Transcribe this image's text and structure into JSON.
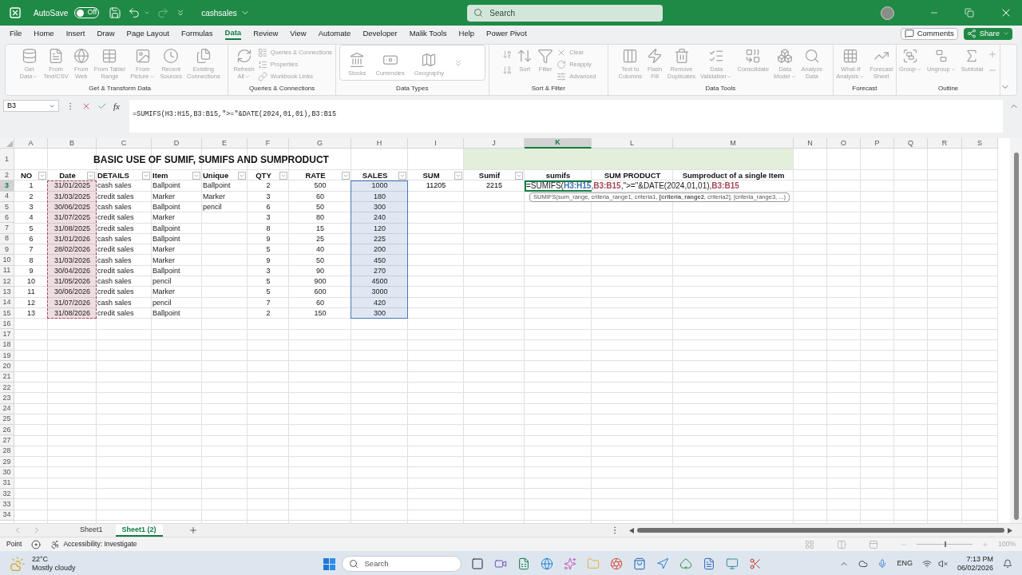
{
  "title_bar": {
    "autosave_label": "AutoSave",
    "autosave": {
      "on": false,
      "label": "Off"
    },
    "redo_disabled": true,
    "file_name": "cashsales",
    "search_placeholder": "Search"
  },
  "menu_tabs": [
    {
      "label": "File",
      "selected": false
    },
    {
      "label": "Home",
      "selected": false
    },
    {
      "label": "Insert",
      "selected": false
    },
    {
      "label": "Draw",
      "selected": false
    },
    {
      "label": "Page Layout",
      "selected": false
    },
    {
      "label": "Formulas",
      "selected": false
    },
    {
      "label": "Data",
      "selected": true
    },
    {
      "label": "Review",
      "selected": false
    },
    {
      "label": "View",
      "selected": false
    },
    {
      "label": "Automate",
      "selected": false
    },
    {
      "label": "Developer",
      "selected": false
    },
    {
      "label": "Malik Tools",
      "selected": false
    },
    {
      "label": "Help",
      "selected": false
    },
    {
      "label": "Power Pivot",
      "selected": false
    }
  ],
  "comments_label": "Comments",
  "share_label": "Share",
  "ribbon": {
    "disabled": true,
    "groups": [
      {
        "title": "Get & Transform Data",
        "kind": "buttons",
        "buttons": [
          {
            "kind": "large",
            "label": "Get\nData",
            "dropdown": true
          },
          {
            "kind": "large",
            "label": "From\nText/CSV",
            "dropdown": false
          },
          {
            "kind": "large",
            "label": "From\nWeb",
            "dropdown": false
          },
          {
            "kind": "large",
            "label": "From Table/\nRange",
            "dropdown": false
          },
          {
            "kind": "large",
            "label": "From\nPicture",
            "dropdown": true
          },
          {
            "kind": "large",
            "label": "Recent\nSources",
            "dropdown": false
          },
          {
            "kind": "large",
            "label": "Existing\nConnections",
            "dropdown": false
          }
        ]
      },
      {
        "title": "Queries & Connections",
        "kind": "buttons",
        "buttons": [
          {
            "kind": "large",
            "label": "Refresh\nAll",
            "dropdown": true
          },
          {
            "kind": "small",
            "label": "Queries & Connections",
            "dropdown": false
          },
          {
            "kind": "small",
            "label": "Properties",
            "dropdown": false
          },
          {
            "kind": "small",
            "label": "Workbook Links",
            "dropdown": false
          }
        ]
      },
      {
        "title": "Data Types",
        "kind": "gallery",
        "buttons": [
          {
            "kind": "large",
            "label": "Stocks",
            "dropdown": false
          },
          {
            "kind": "large",
            "label": "Currencies",
            "dropdown": false
          },
          {
            "kind": "large",
            "label": "Geography",
            "dropdown": false
          },
          {
            "kind": "icon",
            "dropdown": false
          }
        ]
      },
      {
        "title": "Sort & Filter",
        "kind": "buttons",
        "buttons": [
          {
            "kind": "icon",
            "dropdown": false
          },
          {
            "kind": "icon",
            "dropdown": false
          },
          {
            "kind": "large",
            "label": "Sort",
            "dropdown": false
          },
          {
            "kind": "large",
            "label": "Filter",
            "dropdown": false
          },
          {
            "kind": "small",
            "label": "Clear",
            "dropdown": false
          },
          {
            "kind": "small",
            "label": "Reapply",
            "dropdown": false
          },
          {
            "kind": "small",
            "label": "Advanced",
            "dropdown": false
          }
        ]
      },
      {
        "title": "Data Tools",
        "kind": "buttons",
        "buttons": [
          {
            "kind": "large",
            "label": "Text to\nColumns",
            "dropdown": false
          },
          {
            "kind": "large",
            "label": "Flash\nFill",
            "dropdown": false
          },
          {
            "kind": "large",
            "label": "Remove\nDuplicates",
            "dropdown": false
          },
          {
            "kind": "large",
            "label": "Data\nValidation",
            "dropdown": true
          },
          {
            "kind": "large",
            "label": "Consolidate",
            "dropdown": false
          },
          {
            "kind": "large",
            "label": "Data\nModel",
            "dropdown": true
          },
          {
            "kind": "large",
            "label": "Analyze\nData",
            "dropdown": false
          }
        ]
      },
      {
        "title": "Forecast",
        "kind": "buttons",
        "buttons": [
          {
            "kind": "large",
            "label": "What-If\nAnalysis",
            "dropdown": true
          },
          {
            "kind": "large",
            "label": "Forecast\nSheet",
            "dropdown": false
          }
        ]
      },
      {
        "title": "Outline",
        "kind": "buttons",
        "buttons": [
          {
            "kind": "large",
            "label": "Group",
            "dropdown": true
          },
          {
            "kind": "large",
            "label": "Ungroup",
            "dropdown": true
          },
          {
            "kind": "large",
            "label": "Subtotal",
            "dropdown": false
          },
          {
            "kind": "icon",
            "dropdown": false
          },
          {
            "kind": "icon",
            "dropdown": false
          }
        ]
      }
    ]
  },
  "formula_bar": {
    "name_box": "B3",
    "function_label": "fx",
    "formula": "=SUMIFS(H3:H15,B3:B15,\">=\"&DATE(2024,01,01),B3:B15"
  },
  "sheet": {
    "columns": [
      {
        "label": "A",
        "selected": false
      },
      {
        "label": "B",
        "selected": false
      },
      {
        "label": "C",
        "selected": false
      },
      {
        "label": "D",
        "selected": false
      },
      {
        "label": "E",
        "selected": false
      },
      {
        "label": "F",
        "selected": false
      },
      {
        "label": "G",
        "selected": false
      },
      {
        "label": "H",
        "selected": false
      },
      {
        "label": "I",
        "selected": false
      },
      {
        "label": "J",
        "selected": false
      },
      {
        "label": "K",
        "selected": true
      },
      {
        "label": "L",
        "selected": false
      },
      {
        "label": "M",
        "selected": false
      },
      {
        "label": "N",
        "selected": false
      },
      {
        "label": "O",
        "selected": false
      },
      {
        "label": "P",
        "selected": false
      },
      {
        "label": "Q",
        "selected": false
      },
      {
        "label": "R",
        "selected": false
      },
      {
        "label": "S",
        "selected": false
      }
    ],
    "rows": [
      {
        "label": "1",
        "selected": false
      },
      {
        "label": "2",
        "selected": false
      },
      {
        "label": "3",
        "selected": true
      },
      {
        "label": "4",
        "selected": false
      },
      {
        "label": "5",
        "selected": false
      },
      {
        "label": "6",
        "selected": false
      },
      {
        "label": "7",
        "selected": false
      },
      {
        "label": "8",
        "selected": false
      },
      {
        "label": "9",
        "selected": false
      },
      {
        "label": "10",
        "selected": false
      },
      {
        "label": "11",
        "selected": false
      },
      {
        "label": "12",
        "selected": false
      },
      {
        "label": "13",
        "selected": false
      },
      {
        "label": "14",
        "selected": false
      },
      {
        "label": "15",
        "selected": false
      },
      {
        "label": "16",
        "selected": false
      },
      {
        "label": "17",
        "selected": false
      },
      {
        "label": "18",
        "selected": false
      },
      {
        "label": "19",
        "selected": false
      },
      {
        "label": "20",
        "selected": false
      },
      {
        "label": "21",
        "selected": false
      },
      {
        "label": "22",
        "selected": false
      },
      {
        "label": "23",
        "selected": false
      },
      {
        "label": "24",
        "selected": false
      },
      {
        "label": "25",
        "selected": false
      },
      {
        "label": "26",
        "selected": false
      },
      {
        "label": "27",
        "selected": false
      },
      {
        "label": "28",
        "selected": false
      },
      {
        "label": "29",
        "selected": false
      },
      {
        "label": "30",
        "selected": false
      },
      {
        "label": "31",
        "selected": false
      },
      {
        "label": "32",
        "selected": false
      },
      {
        "label": "33",
        "selected": false
      },
      {
        "label": "34",
        "selected": false
      }
    ],
    "title": "BASIC USE OF SUMIF, SUMIFS AND SUMPRODUCT",
    "table": {
      "columns": [
        {
          "header": "NO",
          "filter": true
        },
        {
          "header": "Date",
          "filter": true,
          "reference": {
            "color": "#a8475a",
            "kind": "dashed"
          }
        },
        {
          "header": "DETAILS",
          "filter": true
        },
        {
          "header": "Item",
          "filter": true
        },
        {
          "header": "Unique",
          "filter": true
        },
        {
          "header": "QTY",
          "filter": true
        },
        {
          "header": "RATE",
          "filter": true
        },
        {
          "header": "SALES",
          "filter": true,
          "reference": {
            "color": "#4a78b5",
            "kind": "solid"
          }
        },
        {
          "header": "SUM",
          "filter": true
        },
        {
          "header": "Sumif",
          "filter": true
        },
        {
          "header": "sumifs",
          "filter": false
        },
        {
          "header": "SUM PRODUCT",
          "filter": false
        },
        {
          "header": "Sumproduct of a single Item",
          "filter": false
        }
      ],
      "rows": [
        {
          "no": "1",
          "date": "31/01/2025",
          "details": "cash sales",
          "item": "Ballpoint",
          "unique": "Ballpoint",
          "qty": "2",
          "rate": "500",
          "sales": "1000"
        },
        {
          "no": "2",
          "date": "31/03/2025",
          "details": "credit sales",
          "item": "Marker",
          "unique": "Marker",
          "qty": "3",
          "rate": "60",
          "sales": "180"
        },
        {
          "no": "3",
          "date": "30/06/2025",
          "details": "cash sales",
          "item": "Ballpoint",
          "unique": "pencil",
          "qty": "6",
          "rate": "50",
          "sales": "300"
        },
        {
          "no": "4",
          "date": "31/07/2025",
          "details": "credit sales",
          "item": "Marker",
          "qty": "3",
          "rate": "80",
          "sales": "240"
        },
        {
          "no": "5",
          "date": "31/08/2025",
          "details": "credit sales",
          "item": "Ballpoint",
          "qty": "8",
          "rate": "15",
          "sales": "120"
        },
        {
          "no": "6",
          "date": "31/01/2026",
          "details": "cash sales",
          "item": "Ballpoint",
          "qty": "9",
          "rate": "25",
          "sales": "225"
        },
        {
          "no": "7",
          "date": "28/02/2026",
          "details": "credit sales",
          "item": "Marker",
          "qty": "5",
          "rate": "40",
          "sales": "200"
        },
        {
          "no": "8",
          "date": "31/03/2026",
          "details": "cash sales",
          "item": "Marker",
          "qty": "9",
          "rate": "50",
          "sales": "450"
        },
        {
          "no": "9",
          "date": "30/04/2026",
          "details": "credit sales",
          "item": "Ballpoint",
          "qty": "3",
          "rate": "90",
          "sales": "270"
        },
        {
          "no": "10",
          "date": "31/05/2026",
          "details": "cash sales",
          "item": "pencil",
          "qty": "5",
          "rate": "900",
          "sales": "4500"
        },
        {
          "no": "11",
          "date": "30/06/2026",
          "details": "credit sales",
          "item": "Marker",
          "qty": "5",
          "rate": "600",
          "sales": "3000"
        },
        {
          "no": "12",
          "date": "31/07/2026",
          "details": "cash sales",
          "item": "pencil",
          "qty": "7",
          "rate": "60",
          "sales": "420"
        },
        {
          "no": "13",
          "date": "31/08/2026",
          "details": "credit sales",
          "item": "Ballpoint",
          "qty": "2",
          "rate": "150",
          "sales": "300"
        }
      ]
    },
    "sum_result": "11205",
    "sumif_result": "2215",
    "editing_cell": {
      "segments": [
        {
          "text": "=SUMIFS(",
          "kind": "plain"
        },
        {
          "text": "H3:H15",
          "kind": "reference",
          "color": "#3f6fb0"
        },
        {
          "text": ",",
          "kind": "plain"
        },
        {
          "text": "B3:B15",
          "kind": "reference",
          "color": "#a8475a"
        },
        {
          "text": ",\">=\"&DATE(2024,01,01),",
          "kind": "plain"
        },
        {
          "text": "B3:B15",
          "kind": "reference",
          "color": "#a8475a"
        }
      ]
    },
    "tooltip": "SUMIFS(sum_range, criteria_range1, criteria1, **[criteria_range2**, criteria2], [criteria_range3, ...)"
  },
  "sheet_tabs": [
    {
      "label": "Sheet1",
      "selected": false
    },
    {
      "label": "Sheet1 (2)",
      "selected": true
    }
  ],
  "status_bar": {
    "mode": "Point",
    "accessibility": "Accessibility: Investigate",
    "zoom": {
      "level": 0.5,
      "label": "100%"
    }
  },
  "taskbar": {
    "weather": {
      "temperature": "22°C",
      "condition": "Mostly cloudy"
    },
    "search_placeholder": "Search",
    "language": "ENG",
    "time": "7:13 PM",
    "date": "06/02/2026"
  }
}
